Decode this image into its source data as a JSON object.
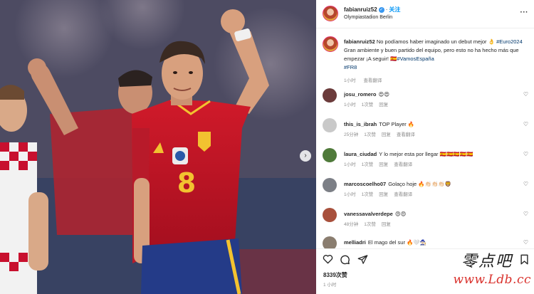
{
  "post": {
    "username": "fabianruiz52",
    "follow_label": "关注",
    "location": "Olympiastadion Berlin",
    "more_label": "···"
  },
  "caption": {
    "username": "fabianruiz52",
    "text_1": "No podíamos haber imaginado un debut mejor 👌",
    "hashtag_1": "#Euro2024",
    "text_2": " Gran ambiente y buen partido del equipo, pero esto no ha hecho más que empezar ¡A seguir! 🇪🇸",
    "hashtag_2": "#VamosEspaña",
    "hashtag_3": "#FR8",
    "time": "1小时",
    "translate_label": "查看翻译"
  },
  "comments": [
    {
      "user": "josu_romero",
      "text": "😍😍",
      "time": "1小时",
      "likes": "1次赞",
      "reply": "回复",
      "translate": "",
      "avatar_color": "#6b3b3b"
    },
    {
      "user": "this_is_ibrah",
      "text": "TOP Player 🔥",
      "time": "25分钟",
      "likes": "1次赞",
      "reply": "回复",
      "translate": "查看翻译",
      "avatar_color": "#c9c9c9"
    },
    {
      "user": "laura_ciudad",
      "text": "Y lo mejor esta por llegar 🇪🇸🇪🇸🇪🇸🇪🇸🇪🇸",
      "time": "1小时",
      "likes": "1次赞",
      "reply": "回复",
      "translate": "查看翻译",
      "avatar_color": "#4f7a3a"
    },
    {
      "user": "marcoscoelho07",
      "text": "Golaço hoje 🔥👏🏻👏🏻👏🏻🦁",
      "time": "1小时",
      "likes": "1次赞",
      "reply": "回复",
      "translate": "查看翻译",
      "avatar_color": "#7c7f86"
    },
    {
      "user": "vanessavalverdepe",
      "text": "😍😍",
      "time": "48分钟",
      "likes": "1次赞",
      "reply": "回复",
      "translate": "",
      "avatar_color": "#a8503c"
    },
    {
      "user": "melliadri",
      "text": "El mago del sur 🔥🤍🧙🏻",
      "time": "",
      "likes": "",
      "reply": "",
      "translate": "",
      "avatar_color": "#8a7d6f"
    }
  ],
  "actions": {
    "likes_count": "8339次赞",
    "time_ago": "1 小时"
  },
  "watermark": {
    "chinese": "零点吧",
    "url": "www.Ldb.cc"
  },
  "colors": {
    "accent": "#0095f6",
    "hashtag": "#00376b",
    "meta_gray": "#8e8e8e",
    "spain_red": "#c8102e",
    "watermark_red": "#d9302b"
  }
}
